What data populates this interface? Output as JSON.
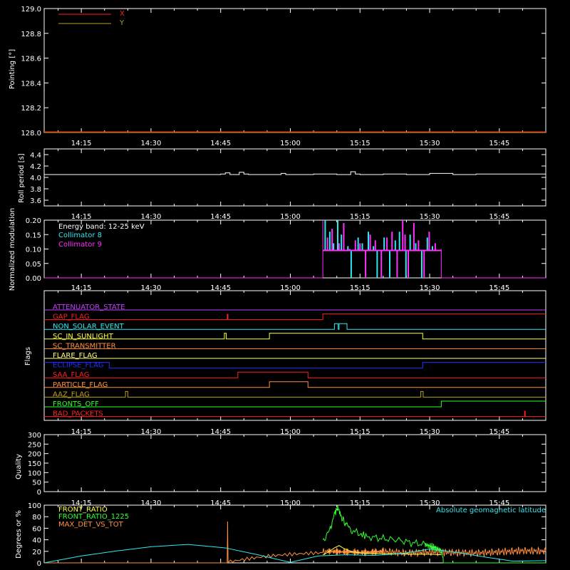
{
  "x_tick_labels": [
    "14:15",
    "14:30",
    "14:45",
    "15:00",
    "15:15",
    "15:30",
    "15:45"
  ],
  "x_tick_minutes": [
    855,
    870,
    885,
    900,
    915,
    930,
    945
  ],
  "x_range_minutes": [
    847,
    955
  ],
  "chart_data": [
    {
      "type": "line",
      "ylabel": "Pointing [°]",
      "ylim": [
        128.0,
        129.0
      ],
      "yticks": [
        128.0,
        128.2,
        128.4,
        128.6,
        128.8,
        129.0
      ],
      "ytick_labels": [
        "128.0",
        "128.2",
        "128.4",
        "128.6",
        "128.8",
        "129.0"
      ],
      "legend": [
        {
          "name": "X",
          "color": "#ff2020"
        },
        {
          "name": "Y",
          "color": "#b8a020"
        }
      ],
      "series": [
        {
          "name": "X",
          "color": "#ff2020",
          "values": []
        },
        {
          "name": "Y",
          "color": "#b8a020",
          "values": []
        }
      ]
    },
    {
      "type": "line",
      "ylabel": "Roll period [s]",
      "ylim": [
        3.5,
        4.5
      ],
      "yticks": [
        3.6,
        3.8,
        4.0,
        4.2,
        4.4
      ],
      "ytick_labels": [
        "3.6",
        "3.8",
        "4.0",
        "4.2",
        "4.4"
      ],
      "series": [
        {
          "color": "#ffffff",
          "x": [
            847,
            870,
            885,
            886,
            887,
            889,
            890,
            891,
            898,
            899,
            900,
            905,
            910,
            913,
            914,
            915,
            920,
            925,
            930,
            935,
            940,
            955
          ],
          "y": [
            4.05,
            4.05,
            4.06,
            4.08,
            4.05,
            4.09,
            4.06,
            4.05,
            4.07,
            4.05,
            4.05,
            4.06,
            4.05,
            4.1,
            4.06,
            4.05,
            4.06,
            4.05,
            4.07,
            4.05,
            4.06,
            4.05
          ]
        }
      ]
    },
    {
      "type": "line",
      "ylabel": "Normalized modulation",
      "ylim": [
        0,
        0.2
      ],
      "yticks": [
        0,
        0.05,
        0.1,
        0.15,
        0.2
      ],
      "ytick_labels": [
        "0.00",
        "0.05",
        "0.10",
        "0.15",
        "0.20"
      ],
      "annotation": "Energy band: 12-25 keV",
      "legend": [
        {
          "name": "Collimator 8",
          "color": "#30e8f0"
        },
        {
          "name": "Collimator 9",
          "color": "#ff30ff"
        }
      ],
      "active_range": [
        907.0,
        932.5
      ],
      "baseline_value": 0.095,
      "series": [
        {
          "name": "Collimator 8",
          "color": "#30e8f0",
          "x": [
            907.5,
            908.5,
            909.3,
            910.2,
            911.0,
            912.4,
            913.1,
            914.6,
            915.5,
            916.8,
            917.9,
            918.7,
            920.2,
            921.4,
            922.6,
            923.5,
            924.9,
            925.8,
            927.0,
            928.3,
            929.5,
            930.6
          ],
          "y": [
            0.2,
            0.16,
            0.12,
            0.2,
            0.15,
            0.11,
            0.0,
            0.14,
            0.12,
            0.16,
            0.11,
            0.0,
            0.14,
            0.0,
            0.13,
            0.16,
            0.0,
            0.15,
            0.12,
            0.0,
            0.14,
            0.11
          ]
        },
        {
          "name": "Collimator 9",
          "color": "#ff30ff",
          "x": [
            908.0,
            909.0,
            910.5,
            911.5,
            912.8,
            914.0,
            915.0,
            916.2,
            917.2,
            918.3,
            919.6,
            920.8,
            921.9,
            923.0,
            924.2,
            924.7,
            925.4,
            926.6,
            927.6,
            928.8,
            929.9,
            931.2
          ],
          "y": [
            0.14,
            0.17,
            0.12,
            0.19,
            0.1,
            0.13,
            0.12,
            0.0,
            0.15,
            0.13,
            0.0,
            0.14,
            0.16,
            0.0,
            0.2,
            0.15,
            0.0,
            0.19,
            0.13,
            0.0,
            0.16,
            0.12
          ]
        }
      ]
    },
    {
      "type": "line",
      "ylabel": "Flags",
      "series": [
        {
          "name": "ATTENUATOR_STATE",
          "color": "#c040ff",
          "steps": []
        },
        {
          "name": "GAP_FLAG",
          "color": "#ff2020",
          "steps": [
            [
              907,
              1
            ]
          ],
          "spikes": [
            886.5
          ]
        },
        {
          "name": "NON_SOLAR_EVENT",
          "color": "#30e8f0",
          "steps": [
            [
              909.5,
              1
            ],
            [
              910.3,
              0
            ],
            [
              910.5,
              1
            ],
            [
              912.2,
              0
            ]
          ]
        },
        {
          "name": "SC_IN_SUNLIGHT",
          "color": "#ffff40",
          "steps": [
            [
              885.8,
              1
            ],
            [
              886.2,
              0
            ],
            [
              895.5,
              1
            ],
            [
              928.5,
              0
            ]
          ]
        },
        {
          "name": "SC_TRANSMITTER",
          "color": "#ff9040",
          "steps": []
        },
        {
          "name": "FLARE_FLAG",
          "color": "#ffff80",
          "steps": []
        },
        {
          "name": "ECLIPSE_FLAG",
          "color": "#2030ff",
          "steps": [
            [
              861,
              0
            ],
            [
              928.5,
              1
            ]
          ],
          "initial": 1
        },
        {
          "name": "SAA_FLAG",
          "color": "#ff2020",
          "steps": [
            [
              888.7,
              1
            ],
            [
              903.8,
              0
            ]
          ]
        },
        {
          "name": "PARTICLE_FLAG",
          "color": "#ff9040",
          "steps": [
            [
              895.5,
              1
            ],
            [
              903.8,
              0
            ]
          ]
        },
        {
          "name": "AAZ_FLAG",
          "color": "#b8a020",
          "steps": [
            [
              864.5,
              1
            ],
            [
              865.0,
              0
            ],
            [
              928.1,
              1
            ],
            [
              928.6,
              0
            ]
          ]
        },
        {
          "name": "FRONTS_OFF",
          "color": "#30ff30",
          "steps": [
            [
              932.5,
              1
            ]
          ]
        },
        {
          "name": "BAD_PACKETS",
          "color": "#ff2020",
          "steps": [],
          "spikes": [
            950.5
          ]
        }
      ]
    },
    {
      "type": "line",
      "ylabel": "Quality",
      "ylim": [
        0,
        300
      ],
      "yticks": [
        0,
        50,
        100,
        150,
        200,
        250,
        300
      ],
      "ytick_labels": [
        "0",
        "50",
        "100",
        "150",
        "200",
        "250",
        "300"
      ],
      "series": [
        {
          "color": "#ffffff",
          "x": [
            847,
            955
          ],
          "y": [
            300,
            300
          ]
        }
      ]
    },
    {
      "type": "line",
      "ylabel": "Degrees or %",
      "ylim": [
        0,
        100
      ],
      "yticks": [
        0,
        20,
        40,
        60,
        80,
        100
      ],
      "ytick_labels": [
        "0",
        "20",
        "40",
        "60",
        "80",
        "100"
      ],
      "legend": [
        {
          "name": "FRONT_RATIO",
          "color": "#ffff40"
        },
        {
          "name": "FRONT_RATIO_1225",
          "color": "#30ff30"
        },
        {
          "name": "MAX_DET_VS_TOT",
          "color": "#ff9040"
        }
      ],
      "annotation": "Absolute geomagnetic latitude",
      "series": [
        {
          "name": "Absolute geomagnetic latitude",
          "color": "#30e8f0",
          "x": [
            847,
            855,
            862,
            870,
            878,
            886,
            893,
            900,
            906,
            912,
            918,
            924,
            930,
            936,
            942,
            948,
            955
          ],
          "y": [
            0,
            12,
            20,
            28,
            32,
            26,
            14,
            1,
            12,
            14,
            13,
            16,
            24,
            18,
            10,
            3,
            4
          ]
        },
        {
          "name": "FRONT_RATIO",
          "color": "#ffff40",
          "x": [
            907.0,
            908.0,
            909.5,
            910.5,
            911.5,
            913.0,
            915.0,
            918.0,
            922.0,
            926.0,
            930.0,
            932.5
          ],
          "y": [
            14,
            18,
            26,
            30,
            25,
            20,
            17,
            16,
            16,
            15,
            15,
            14
          ]
        },
        {
          "name": "FRONT_RATIO_1225",
          "color": "#30ff30",
          "x": [
            907.0,
            908.5,
            909.5,
            910.2,
            911.0,
            912.0,
            913.5,
            915.0,
            917.0,
            920.0,
            923.0,
            926.0,
            929.0,
            932.5,
            933.0,
            955.0
          ],
          "y": [
            40,
            55,
            85,
            96,
            80,
            65,
            55,
            50,
            45,
            42,
            40,
            35,
            32,
            22,
            0,
            0
          ]
        },
        {
          "name": "MAX_DET_VS_TOT",
          "color": "#ff9040",
          "x": [
            847,
            886.4,
            886.5,
            886.6,
            907,
            908,
            912,
            916,
            920,
            925,
            930,
            935,
            940,
            945,
            950,
            955
          ],
          "y": [
            0,
            0,
            68,
            0,
            18,
            20,
            19,
            18,
            20,
            17,
            19,
            18,
            17,
            19,
            21,
            20
          ]
        }
      ]
    }
  ]
}
